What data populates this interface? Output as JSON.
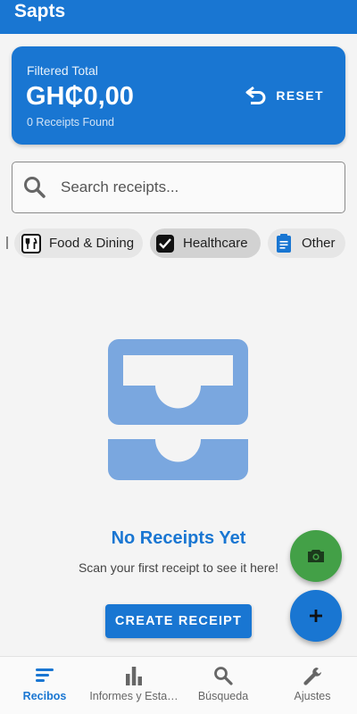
{
  "app": {
    "title": "Sapts"
  },
  "summary": {
    "label": "Filtered Total",
    "amount": "GH₵0,00",
    "count_text": "0 Receipts Found",
    "reset_label": "RESET"
  },
  "search": {
    "placeholder": "Search receipts..."
  },
  "chips": [
    {
      "label": "Food & Dining",
      "icon": "restaurant-icon",
      "selected": false
    },
    {
      "label": "Healthcare",
      "icon": "checkbox-icon",
      "selected": true
    },
    {
      "label": "Other",
      "icon": "document-icon",
      "selected": false
    }
  ],
  "empty_state": {
    "icon": "inbox-tray-icon",
    "title": "No Receipts Yet",
    "subtitle": "Scan your first receipt to see it here!",
    "button_label": "CREATE RECEIPT"
  },
  "fabs": {
    "camera_icon": "camera-icon",
    "add_icon": "add-icon"
  },
  "bottom_nav": {
    "items": [
      {
        "label": "Recibos",
        "icon": "receipt-list-icon",
        "active": true
      },
      {
        "label": "Informes y Esta…",
        "icon": "bar-chart-icon",
        "active": false
      },
      {
        "label": "Búsqueda",
        "icon": "search-icon",
        "active": false
      },
      {
        "label": "Ajustes",
        "icon": "wrench-icon",
        "active": false
      }
    ]
  },
  "colors": {
    "primary": "#1976d2",
    "accent_green": "#43a047",
    "illustration": "#7aa7df"
  }
}
